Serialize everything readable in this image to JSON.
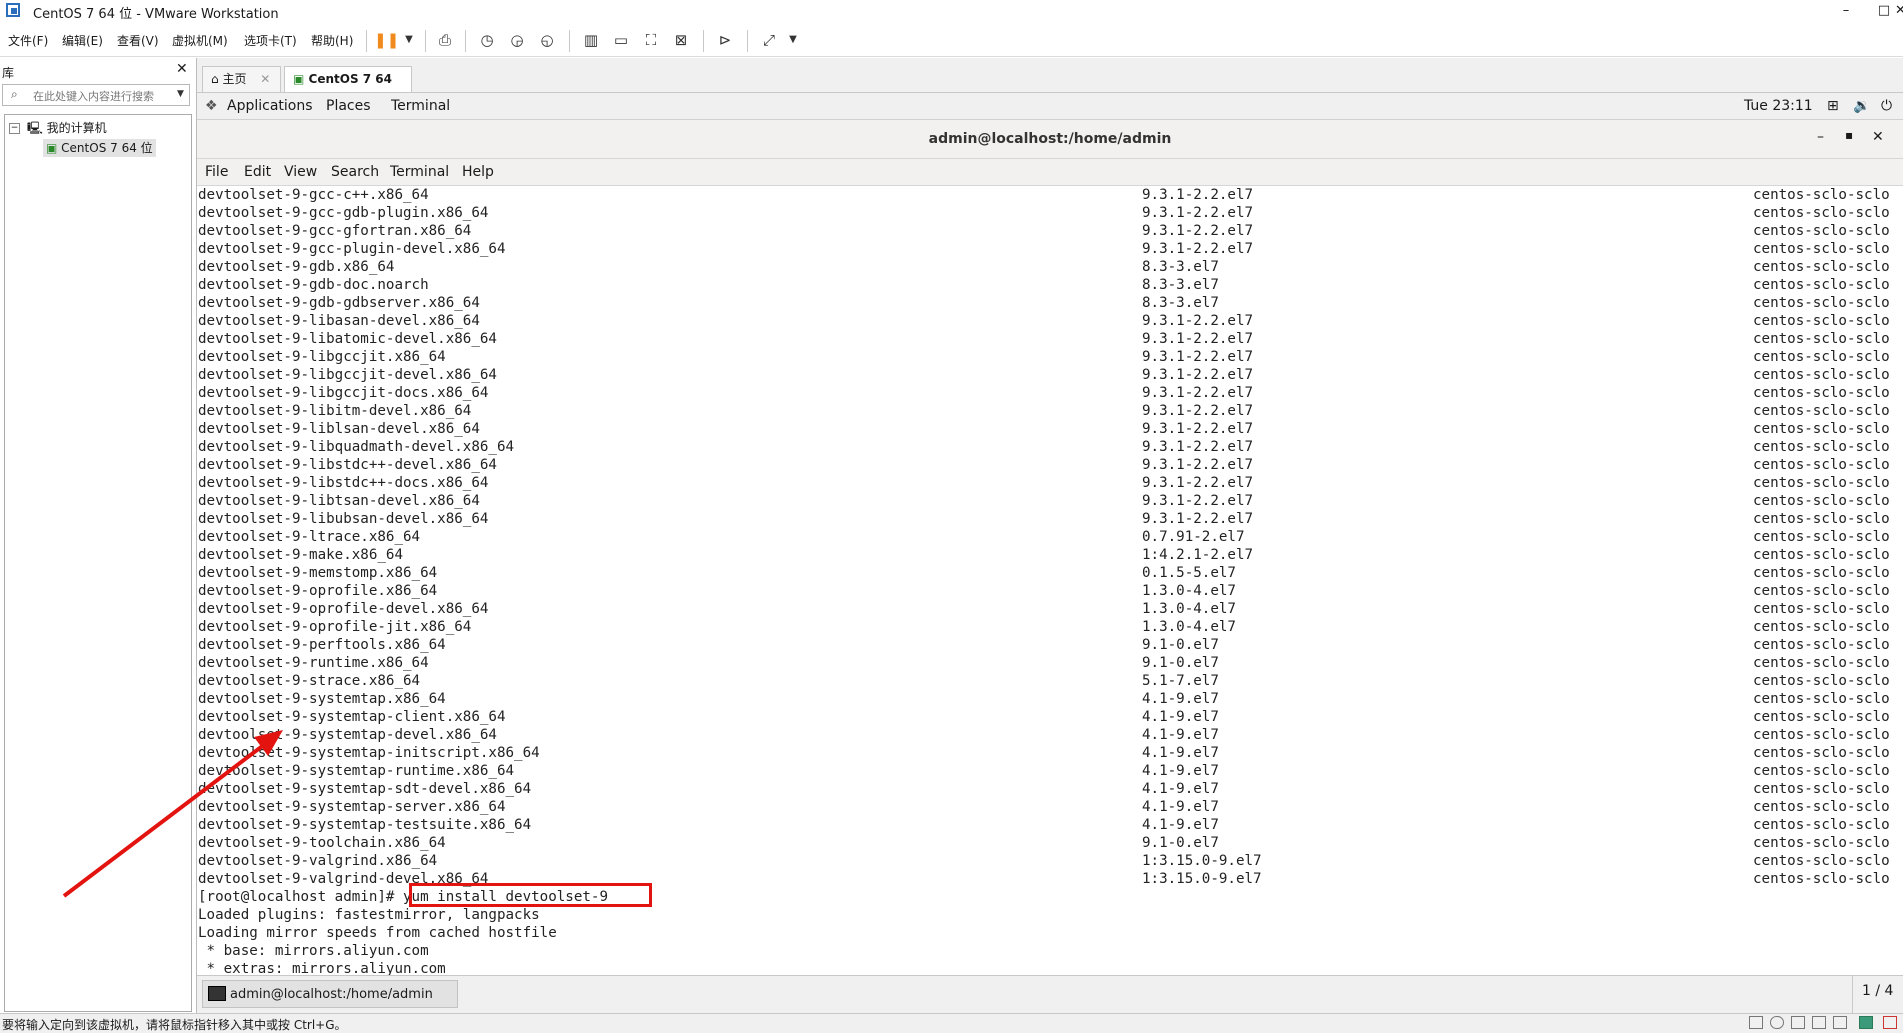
{
  "window": {
    "title": "CentOS 7 64 位 - VMware Workstation",
    "minimize": "–",
    "maximize": "□",
    "close": "✕"
  },
  "menu": [
    "文件(F)",
    "编辑(E)",
    "查看(V)",
    "虚拟机(M)",
    "选项卡(T)",
    "帮助(H)"
  ],
  "library": {
    "title": "库",
    "close": "✕",
    "search_placeholder": "在此处键入内容进行搜索",
    "tree": {
      "root": "我的计算机",
      "child": "CentOS 7 64 位"
    }
  },
  "tabs": [
    {
      "label": "主页",
      "close": "✕"
    },
    {
      "label": "CentOS 7 64 位",
      "close": "✕"
    }
  ],
  "gnome": {
    "applications": "Applications",
    "places": "Places",
    "terminal": "Terminal",
    "clock": "Tue 23:11"
  },
  "terminal": {
    "title": "admin@localhost:/home/admin",
    "menu": [
      "File",
      "Edit",
      "View",
      "Search",
      "Terminal",
      "Help"
    ],
    "package_rows": [
      [
        "devtoolset-9-gcc-c++.x86_64",
        "9.3.1-2.2.el7",
        "centos-sclo-sclo"
      ],
      [
        "devtoolset-9-gcc-gdb-plugin.x86_64",
        "9.3.1-2.2.el7",
        "centos-sclo-sclo"
      ],
      [
        "devtoolset-9-gcc-gfortran.x86_64",
        "9.3.1-2.2.el7",
        "centos-sclo-sclo"
      ],
      [
        "devtoolset-9-gcc-plugin-devel.x86_64",
        "9.3.1-2.2.el7",
        "centos-sclo-sclo"
      ],
      [
        "devtoolset-9-gdb.x86_64",
        "8.3-3.el7",
        "centos-sclo-sclo"
      ],
      [
        "devtoolset-9-gdb-doc.noarch",
        "8.3-3.el7",
        "centos-sclo-sclo"
      ],
      [
        "devtoolset-9-gdb-gdbserver.x86_64",
        "8.3-3.el7",
        "centos-sclo-sclo"
      ],
      [
        "devtoolset-9-libasan-devel.x86_64",
        "9.3.1-2.2.el7",
        "centos-sclo-sclo"
      ],
      [
        "devtoolset-9-libatomic-devel.x86_64",
        "9.3.1-2.2.el7",
        "centos-sclo-sclo"
      ],
      [
        "devtoolset-9-libgccjit.x86_64",
        "9.3.1-2.2.el7",
        "centos-sclo-sclo"
      ],
      [
        "devtoolset-9-libgccjit-devel.x86_64",
        "9.3.1-2.2.el7",
        "centos-sclo-sclo"
      ],
      [
        "devtoolset-9-libgccjit-docs.x86_64",
        "9.3.1-2.2.el7",
        "centos-sclo-sclo"
      ],
      [
        "devtoolset-9-libitm-devel.x86_64",
        "9.3.1-2.2.el7",
        "centos-sclo-sclo"
      ],
      [
        "devtoolset-9-liblsan-devel.x86_64",
        "9.3.1-2.2.el7",
        "centos-sclo-sclo"
      ],
      [
        "devtoolset-9-libquadmath-devel.x86_64",
        "9.3.1-2.2.el7",
        "centos-sclo-sclo"
      ],
      [
        "devtoolset-9-libstdc++-devel.x86_64",
        "9.3.1-2.2.el7",
        "centos-sclo-sclo"
      ],
      [
        "devtoolset-9-libstdc++-docs.x86_64",
        "9.3.1-2.2.el7",
        "centos-sclo-sclo"
      ],
      [
        "devtoolset-9-libtsan-devel.x86_64",
        "9.3.1-2.2.el7",
        "centos-sclo-sclo"
      ],
      [
        "devtoolset-9-libubsan-devel.x86_64",
        "9.3.1-2.2.el7",
        "centos-sclo-sclo"
      ],
      [
        "devtoolset-9-ltrace.x86_64",
        "0.7.91-2.el7",
        "centos-sclo-sclo"
      ],
      [
        "devtoolset-9-make.x86_64",
        "1:4.2.1-2.el7",
        "centos-sclo-sclo"
      ],
      [
        "devtoolset-9-memstomp.x86_64",
        "0.1.5-5.el7",
        "centos-sclo-sclo"
      ],
      [
        "devtoolset-9-oprofile.x86_64",
        "1.3.0-4.el7",
        "centos-sclo-sclo"
      ],
      [
        "devtoolset-9-oprofile-devel.x86_64",
        "1.3.0-4.el7",
        "centos-sclo-sclo"
      ],
      [
        "devtoolset-9-oprofile-jit.x86_64",
        "1.3.0-4.el7",
        "centos-sclo-sclo"
      ],
      [
        "devtoolset-9-perftools.x86_64",
        "9.1-0.el7",
        "centos-sclo-sclo"
      ],
      [
        "devtoolset-9-runtime.x86_64",
        "9.1-0.el7",
        "centos-sclo-sclo"
      ],
      [
        "devtoolset-9-strace.x86_64",
        "5.1-7.el7",
        "centos-sclo-sclo"
      ],
      [
        "devtoolset-9-systemtap.x86_64",
        "4.1-9.el7",
        "centos-sclo-sclo"
      ],
      [
        "devtoolset-9-systemtap-client.x86_64",
        "4.1-9.el7",
        "centos-sclo-sclo"
      ],
      [
        "devtoolset-9-systemtap-devel.x86_64",
        "4.1-9.el7",
        "centos-sclo-sclo"
      ],
      [
        "devtoolset-9-systemtap-initscript.x86_64",
        "4.1-9.el7",
        "centos-sclo-sclo"
      ],
      [
        "devtoolset-9-systemtap-runtime.x86_64",
        "4.1-9.el7",
        "centos-sclo-sclo"
      ],
      [
        "devtoolset-9-systemtap-sdt-devel.x86_64",
        "4.1-9.el7",
        "centos-sclo-sclo"
      ],
      [
        "devtoolset-9-systemtap-server.x86_64",
        "4.1-9.el7",
        "centos-sclo-sclo"
      ],
      [
        "devtoolset-9-systemtap-testsuite.x86_64",
        "4.1-9.el7",
        "centos-sclo-sclo"
      ],
      [
        "devtoolset-9-toolchain.x86_64",
        "9.1-0.el7",
        "centos-sclo-sclo"
      ],
      [
        "devtoolset-9-valgrind.x86_64",
        "1:3.15.0-9.el7",
        "centos-sclo-sclo"
      ],
      [
        "devtoolset-9-valgrind-devel.x86_64",
        "1:3.15.0-9.el7",
        "centos-sclo-sclo"
      ]
    ],
    "prompt": "[root@localhost admin]# ",
    "command": "yum install devtoolset-9",
    "output": [
      "Loaded plugins: fastestmirror, langpacks",
      "Loading mirror speeds from cached hostfile",
      " * base: mirrors.aliyun.com",
      " * extras: mirrors.aliyun.com"
    ]
  },
  "taskbar": {
    "item": "admin@localhost:/home/admin",
    "page": "1 / 4"
  },
  "statusbar": {
    "message": "要将输入定向到该虚拟机，请将鼠标指针移入其中或按 Ctrl+G。"
  },
  "colors": {
    "annotation": "#e3140f",
    "pause_icon": "#f08a1c"
  }
}
